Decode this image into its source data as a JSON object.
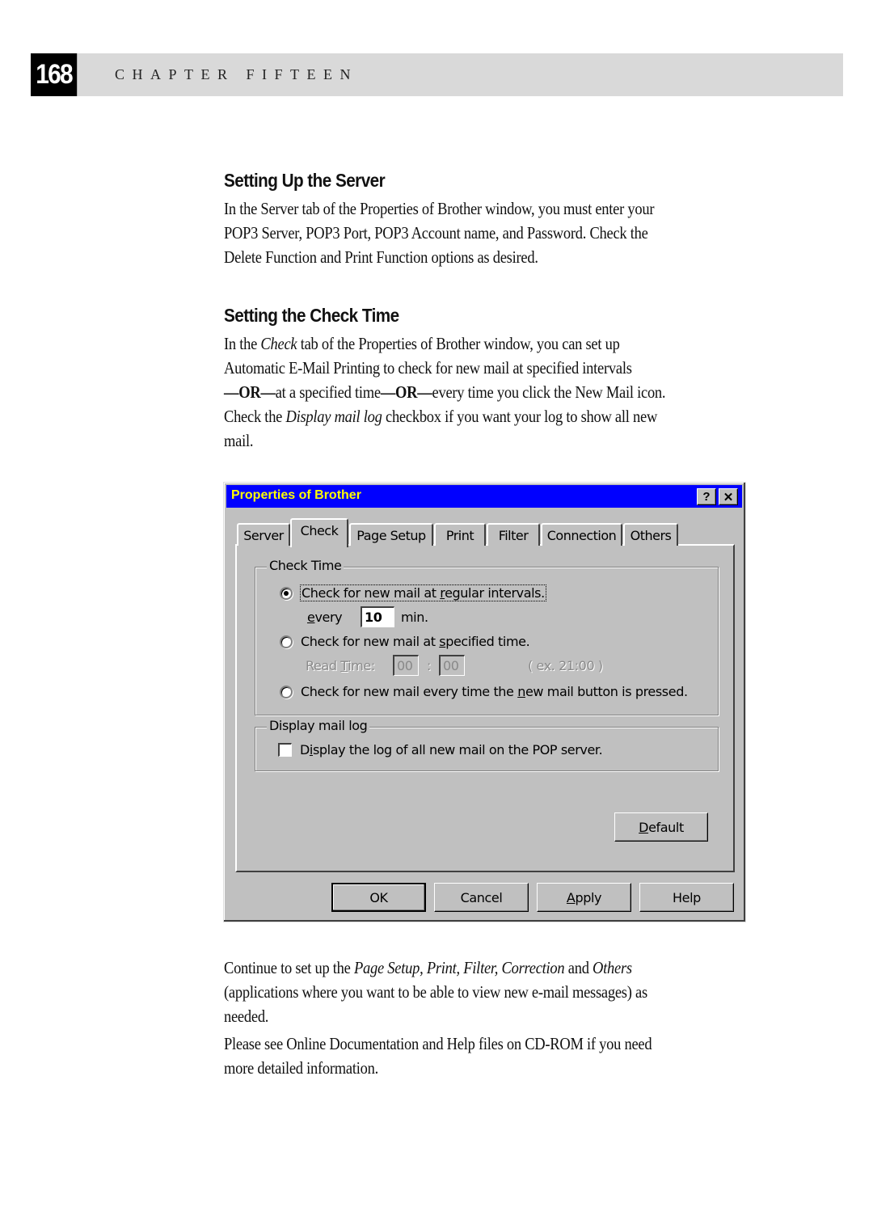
{
  "header": {
    "page_number": "168",
    "chapter_title": "CHAPTER FIFTEEN"
  },
  "section1": {
    "heading": "Setting Up the Server",
    "lines": [
      "In the Server tab of the Properties of Brother window, you must enter your",
      "POP3 Server, POP3 Port, POP3 Account name, and Password. Check the",
      "Delete  Function and Print Function options as desired."
    ]
  },
  "section2": {
    "heading": "Setting the Check Time",
    "line1_pre": "In the ",
    "line1_em": "Check",
    "line1_post": " tab of the Properties of Brother window, you can set up",
    "line2": "Automatic E-Mail Printing to check for new mail at specified intervals",
    "line3_or1": "—OR—",
    "line3_mid": "at a specified time",
    "line3_or2": "—OR—",
    "line3_post": "every time you click the New Mail icon.",
    "line4_pre": "Check the ",
    "line4_em": "Display mail log",
    "line4_post": " checkbox if you want your log to show all new",
    "line5": "mail."
  },
  "dialog": {
    "title": "Properties of Brother",
    "help_button": "?",
    "close_button": "✕",
    "tabs": [
      {
        "label": "Server",
        "active": false
      },
      {
        "label": "Check",
        "active": true
      },
      {
        "label": "Page Setup",
        "active": false
      },
      {
        "label": "Print",
        "active": false
      },
      {
        "label": "Filter",
        "active": false
      },
      {
        "label": "Connection",
        "active": false
      },
      {
        "label": "Others",
        "active": false
      }
    ],
    "check_time": {
      "legend": "Check Time",
      "option1_pre": "Check for new mail at ",
      "option1_u": "r",
      "option1_post": "egular intervals.",
      "option1_selected": true,
      "every_u": "e",
      "every_post": "very",
      "interval_value": "10",
      "min_label": "min.",
      "option2_pre": "Check for new mail at ",
      "option2_u": "s",
      "option2_post": "pecified time.",
      "option2_selected": false,
      "read_time_pre": "Read ",
      "read_time_u": "T",
      "read_time_post": "ime:",
      "hour_value": "00",
      "colon": ":",
      "minute_value": "00",
      "example": "( ex. 21:00 )",
      "option3_pre": "Check for new mail every time the ",
      "option3_u": "n",
      "option3_post": "ew mail button is pressed.",
      "option3_selected": false
    },
    "mail_log": {
      "legend": "Display mail log",
      "checkbox_pre": "D",
      "checkbox_u": "i",
      "checkbox_post": "splay the log of all new mail on the POP server.",
      "checked": false
    },
    "buttons": {
      "default_u": "D",
      "default_post": "efault",
      "ok": "OK",
      "cancel": "Cancel",
      "apply_u": "A",
      "apply_post": "pply",
      "help": "Help"
    },
    "colors": {
      "titlebar": "#0000ff",
      "title_text": "#ffff00",
      "face": "#c0c0c0"
    }
  },
  "after": {
    "p1_l1_pre": "Continue to set up the ",
    "p1_l1_em1": "Page Setup, Print, Filter, Correction",
    "p1_l1_mid": " and ",
    "p1_l1_em2": "Others",
    "p1_l2": "(applications where you want to be able to view new e-mail messages) as",
    "p1_l3": "needed.",
    "p2_l1": "Please see Online Documentation and Help files on CD-ROM if you need",
    "p2_l2": "more detailed information."
  }
}
